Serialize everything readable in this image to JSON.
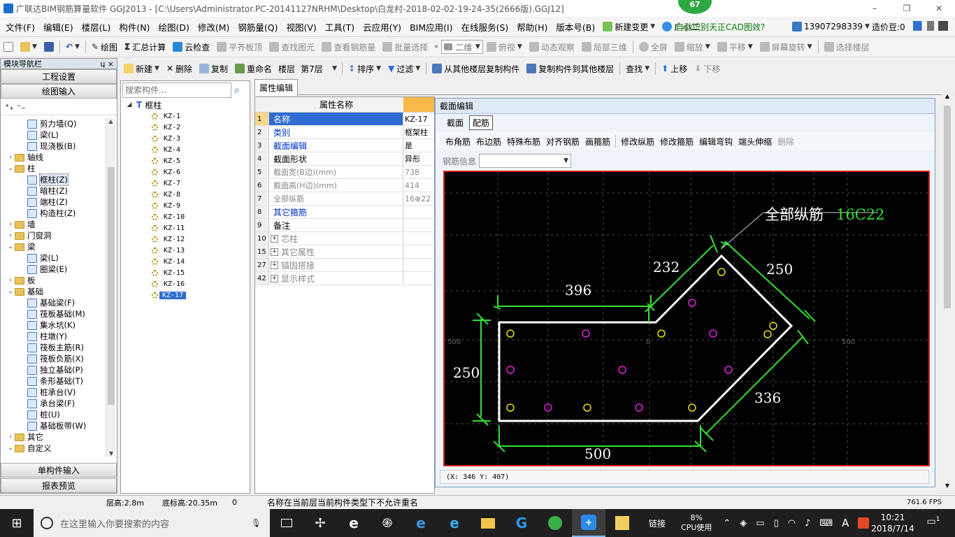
{
  "title_bar": {
    "title": "广联达BIM钢筋算量软件 GGJ2013 - [C:\\Users\\Administrator.PC-20141127NRHM\\Desktop\\白龙村-2018-02-02-19-24-35(2666版).GGJ12]",
    "badge": "67"
  },
  "menu": {
    "items": [
      "文件(F)",
      "编辑(E)",
      "楼层(L)",
      "构件(N)",
      "绘图(D)",
      "修改(M)",
      "钢筋量(Q)",
      "视图(V)",
      "工具(T)",
      "云应用(Y)",
      "BIM应用(I)",
      "在线服务(S)",
      "帮助(H)",
      "版本号(B)"
    ],
    "new_change": "新建变更",
    "assistant": "广小二",
    "promo": "自动识别天正CAD图效?",
    "phone": "13907298339",
    "price_bean": "造价豆:0"
  },
  "toolbar1": {
    "draw": "绘图",
    "summary": "汇总计算",
    "cloud_check": "云检查",
    "level_top": "平齐板顶",
    "find_element": "查找图元",
    "view_rebar": "查看钢筋量",
    "batch_select": "批量选择",
    "view_mode": "二维",
    "top_view": "俯视",
    "dynamic_view": "动态观察",
    "local_3d": "局部三维",
    "fullscreen": "全屏",
    "zoom": "缩放",
    "pan": "平移",
    "screen_rotate": "屏幕旋转",
    "select_floor": "选择楼层"
  },
  "left_panel": {
    "title": "模块导航栏",
    "pin": "ɥ ×",
    "project_settings": "工程设置",
    "drawing_input": "绘图输入",
    "single_input": "单构件输入",
    "report_preview": "报表预览",
    "tree": [
      {
        "label": "剪力墙(Q)",
        "level": 2,
        "type": "item"
      },
      {
        "label": "梁(L)",
        "level": 2,
        "type": "item"
      },
      {
        "label": "现浇板(B)",
        "level": 2,
        "type": "item"
      },
      {
        "label": "轴线",
        "level": 1,
        "type": "folder",
        "state": "collapsed"
      },
      {
        "label": "柱",
        "level": 1,
        "type": "folder",
        "state": "expanded"
      },
      {
        "label": "框柱(Z)",
        "level": 2,
        "type": "item",
        "selected": true
      },
      {
        "label": "暗柱(Z)",
        "level": 2,
        "type": "item"
      },
      {
        "label": "端柱(Z)",
        "level": 2,
        "type": "item"
      },
      {
        "label": "构造柱(Z)",
        "level": 2,
        "type": "item"
      },
      {
        "label": "墙",
        "level": 1,
        "type": "folder",
        "state": "collapsed"
      },
      {
        "label": "门窗洞",
        "level": 1,
        "type": "folder",
        "state": "collapsed"
      },
      {
        "label": "梁",
        "level": 1,
        "type": "folder",
        "state": "expanded"
      },
      {
        "label": "梁(L)",
        "level": 2,
        "type": "item"
      },
      {
        "label": "圈梁(E)",
        "level": 2,
        "type": "item"
      },
      {
        "label": "板",
        "level": 1,
        "type": "folder",
        "state": "collapsed"
      },
      {
        "label": "基础",
        "level": 1,
        "type": "folder",
        "state": "expanded"
      },
      {
        "label": "基础梁(F)",
        "level": 2,
        "type": "item"
      },
      {
        "label": "筏板基础(M)",
        "level": 2,
        "type": "item"
      },
      {
        "label": "集水坑(K)",
        "level": 2,
        "type": "item"
      },
      {
        "label": "柱墩(Y)",
        "level": 2,
        "type": "item"
      },
      {
        "label": "筏板主筋(R)",
        "level": 2,
        "type": "item"
      },
      {
        "label": "筏板负筋(X)",
        "level": 2,
        "type": "item"
      },
      {
        "label": "独立基础(P)",
        "level": 2,
        "type": "item"
      },
      {
        "label": "条形基础(T)",
        "level": 2,
        "type": "item"
      },
      {
        "label": "桩承台(V)",
        "level": 2,
        "type": "item"
      },
      {
        "label": "承台梁(F)",
        "level": 2,
        "type": "item"
      },
      {
        "label": "桩(U)",
        "level": 2,
        "type": "item"
      },
      {
        "label": "基础板带(W)",
        "level": 2,
        "type": "item"
      },
      {
        "label": "其它",
        "level": 1,
        "type": "folder",
        "state": "collapsed"
      },
      {
        "label": "自定义",
        "level": 1,
        "type": "folder",
        "state": "expanded"
      }
    ]
  },
  "toolbar2": {
    "new": "新建",
    "delete": "删除",
    "copy": "复制",
    "rename": "重命名",
    "floor_label": "楼层",
    "floor_value": "第7层",
    "sort": "排序",
    "filter": "过滤",
    "copy_from_floor": "从其他楼层复制构件",
    "copy_to_floor": "复制构件到其他楼层",
    "find": "查找",
    "move_up": "上移",
    "move_down": "下移"
  },
  "component_list": {
    "search_placeholder": "搜索构件...",
    "root": "框柱",
    "items": [
      "KZ-1",
      "KZ-2",
      "KZ-3",
      "KZ-4",
      "KZ-5",
      "KZ-6",
      "KZ-7",
      "KZ-8",
      "KZ-9",
      "KZ-10",
      "KZ-11",
      "KZ-12",
      "KZ-13",
      "KZ-14",
      "KZ-15",
      "KZ-16",
      "KZ-17"
    ],
    "selected": "KZ-17"
  },
  "property_editor": {
    "tab": "属性编辑",
    "header_name": "属性名称",
    "rows": [
      {
        "n": "1",
        "name": "名称",
        "value": "KZ-17",
        "style": "blue"
      },
      {
        "n": "2",
        "name": "类别",
        "value": "框架柱",
        "style": "blue"
      },
      {
        "n": "3",
        "name": "截面编辑",
        "value": "是",
        "style": "blue"
      },
      {
        "n": "4",
        "name": "截面形状",
        "value": "异形",
        "style": "normal"
      },
      {
        "n": "5",
        "name": "截面宽(B边)(mm)",
        "value": "738",
        "style": "gray"
      },
      {
        "n": "6",
        "name": "截面高(H边)(mm)",
        "value": "414",
        "style": "gray"
      },
      {
        "n": "7",
        "name": "全部纵筋",
        "value": "16⊕22",
        "style": "gray"
      },
      {
        "n": "8",
        "name": "其它箍筋",
        "value": "",
        "style": "blue"
      },
      {
        "n": "9",
        "name": "备注",
        "value": "",
        "style": "normal"
      },
      {
        "n": "10",
        "name": "芯柱",
        "value": "",
        "style": "gray",
        "expand": true
      },
      {
        "n": "15",
        "name": "其它属性",
        "value": "",
        "style": "gray",
        "expand": true
      },
      {
        "n": "27",
        "name": "锚固搭接",
        "value": "",
        "style": "gray",
        "expand": true
      },
      {
        "n": "42",
        "name": "显示样式",
        "value": "",
        "style": "gray",
        "expand": true
      }
    ]
  },
  "section_editor": {
    "title": "截面编辑",
    "tabs": [
      "截面",
      "配筋"
    ],
    "active_tab": "配筋",
    "tools": [
      "布角筋",
      "布边筋",
      "特殊布筋",
      "对齐钢筋",
      "画箍筋",
      "修改纵筋",
      "修改箍筋",
      "编辑弯钩",
      "端头伸缩",
      "删除"
    ],
    "rebar_info_label": "钢筋信息",
    "rebar_info_value": "",
    "coord_readout": "(X: 346 Y: 407)",
    "drawing": {
      "rebar_label": "全部纵筋",
      "rebar_value": "16C22",
      "dims": [
        "396",
        "232",
        "250",
        "250",
        "336",
        "500"
      ],
      "axis_ticks": [
        "500",
        "0",
        "500"
      ],
      "colors": {
        "outline": "#ffffff",
        "dimension": "#33e033",
        "corner_bar": "#e8e000",
        "side_bar": "#e020e0",
        "background": "#000000"
      }
    }
  },
  "status_bar": {
    "floor_height": "层高:2.8m",
    "bottom_elevation": "底标高:20.35m",
    "count": "0",
    "message": "名称在当前层当前构件类型下不允许重名",
    "fps": "761.6 FPS"
  },
  "taskbar": {
    "search_placeholder": "在这里输入你要搜索的内容",
    "link": "链接",
    "cpu_percent": "8%",
    "cpu_label": "CPU使用",
    "ime": "A",
    "time": "10:21",
    "date": "2018/7/14",
    "notif": "1"
  }
}
